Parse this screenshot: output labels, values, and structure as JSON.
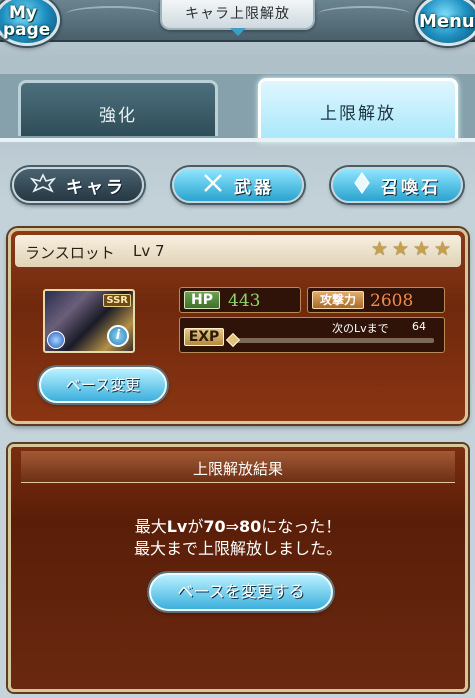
{
  "header": {
    "mypage_label_1": "My",
    "mypage_label_2": "page",
    "title": "キャラ上限解放",
    "menu_label": "Menu"
  },
  "tabs": [
    {
      "label": "強化",
      "active": false
    },
    {
      "label": "上限解放",
      "active": true
    }
  ],
  "filters": [
    {
      "label": "キャラ",
      "icon": "emblem-icon",
      "selected": true
    },
    {
      "label": "武器",
      "icon": "crossed-swords-icon",
      "selected": false
    },
    {
      "label": "召喚石",
      "icon": "crystal-icon",
      "selected": false
    }
  ],
  "character": {
    "name": "ランスロット",
    "level": "Lv 7",
    "stars": 4,
    "rarity": "SSR",
    "hp_label": "HP",
    "hp": "443",
    "atk_label": "攻撃力",
    "atk": "2608",
    "exp_label": "EXP",
    "next_label": "次のLvまで",
    "next_value": "64",
    "exp_progress": 0.0,
    "base_change_label": "ベース変更"
  },
  "result": {
    "title": "上限解放結果",
    "line1_prefix": "最大",
    "line1_lv": "Lv",
    "line1_mid": "が",
    "line1_from": "70",
    "line1_arrow": "⇒",
    "line1_to": "80",
    "line1_suffix": "になった！",
    "line2": "最大まで上限解放しました。",
    "button_label": "ベースを変更する"
  },
  "colors": {
    "accent": "#3cb0dd",
    "panel": "#70290d",
    "hp": "#8fd46a",
    "atk": "#f08a4c"
  }
}
